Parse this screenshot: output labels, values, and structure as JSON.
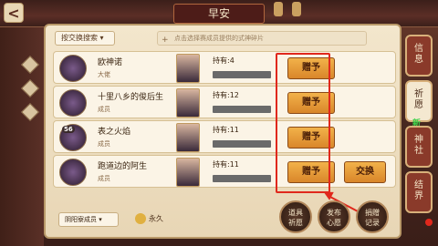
{
  "window": {
    "title": "早安"
  },
  "filter": {
    "label": "按交换搜索"
  },
  "search": {
    "placeholder": "点击选择赛成员提供的式神碎片"
  },
  "rows": [
    {
      "level": "",
      "name": "欧神诺",
      "role": "大佬",
      "own": "持有:4",
      "progress": 0.0,
      "gift": "赠予",
      "swap": ""
    },
    {
      "level": "",
      "name": "十里八乡的俊后生",
      "role": "成员",
      "own": "持有:12",
      "progress": 0.0,
      "gift": "赠予",
      "swap": ""
    },
    {
      "level": "56",
      "name": "表之火焰",
      "role": "成员",
      "own": "持有:11",
      "progress": 0.0,
      "gift": "赠予",
      "swap": ""
    },
    {
      "level": "",
      "name": "跑道边的阿生",
      "role": "成员",
      "own": "持有:11",
      "progress": 0.0,
      "gift": "赠予",
      "swap": "交换"
    }
  ],
  "bottom": {
    "member_filter": "阴阳寮成员",
    "permission": "永久",
    "buttons": [
      {
        "line1": "道具",
        "line2": "祈愿"
      },
      {
        "line1": "发布",
        "line2": "心愿"
      },
      {
        "line1": "捐赠",
        "line2": "记录"
      }
    ]
  },
  "tabs": [
    {
      "label1": "信",
      "label2": "息"
    },
    {
      "label1": "祈",
      "label2": "愿"
    },
    {
      "label1": "神",
      "label2": "社"
    },
    {
      "label1": "结",
      "label2": "界"
    }
  ],
  "tab_badge": "新"
}
